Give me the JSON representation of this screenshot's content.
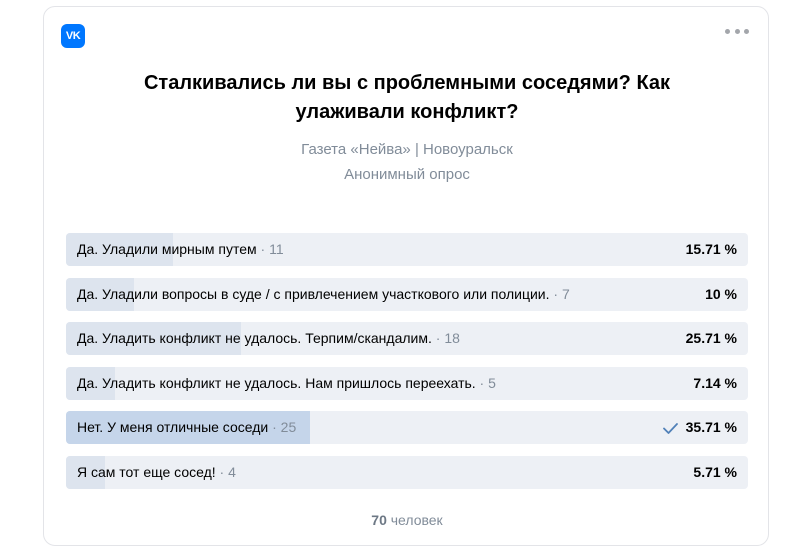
{
  "logo": {
    "text": "VK",
    "color": "#0077ff"
  },
  "menu_icon": "more-horizontal-icon",
  "poll": {
    "title": "Сталкивались ли вы с проблемными соседями? Как улаживали конфликт?",
    "source": "Газета «Нейва» | Новоуральск",
    "kind": "Анонимный опрос",
    "options": [
      {
        "text": "Да. Уладили мирным путем",
        "sep": " · ",
        "count": "11",
        "percent": "15.71 %",
        "fraction": 0.1571,
        "chosen": false
      },
      {
        "text": "Да. Уладили вопросы в суде / с привлечением участкового или полиции.",
        "sep": " · ",
        "count": "7",
        "percent": "10 %",
        "fraction": 0.1,
        "chosen": false
      },
      {
        "text": "Да. Уладить конфликт не удалось. Терпим/скандалим.",
        "sep": " · ",
        "count": "18",
        "percent": "25.71 %",
        "fraction": 0.2571,
        "chosen": false
      },
      {
        "text": "Да. Уладить конфликт не удалось. Нам пришлось переехать.",
        "sep": " · ",
        "count": "5",
        "percent": "7.14 %",
        "fraction": 0.0714,
        "chosen": false
      },
      {
        "text": "Нет. У меня отличные соседи",
        "sep": " · ",
        "count": "25",
        "percent": "35.71 %",
        "fraction": 0.3571,
        "chosen": true
      },
      {
        "text": "Я сам тот еще сосед!",
        "sep": " · ",
        "count": "4",
        "percent": "5.71 %",
        "fraction": 0.0571,
        "chosen": false
      }
    ],
    "total_count": "70",
    "total_label": "человек"
  },
  "colors": {
    "fill": "#dde4ee",
    "fill_chosen": "#c5d5ea",
    "track": "#edf0f5",
    "muted": "#818c99",
    "check": "#5181b8"
  }
}
